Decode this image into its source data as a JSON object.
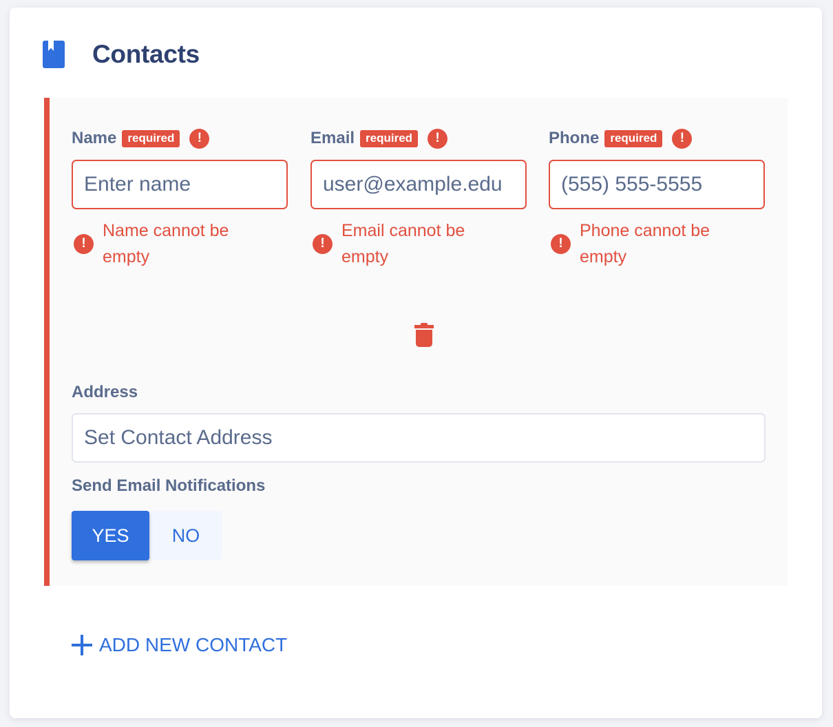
{
  "section": {
    "title": "Contacts",
    "icon": "bookmark-book-icon"
  },
  "contact": {
    "fields": [
      {
        "key": "name",
        "label": "Name",
        "badge": "required",
        "placeholder": "Enter name",
        "value": "",
        "error": "Name cannot be empty"
      },
      {
        "key": "email",
        "label": "Email",
        "badge": "required",
        "placeholder": "user@example.edu",
        "value": "",
        "error": "Email cannot be empty"
      },
      {
        "key": "phone",
        "label": "Phone",
        "badge": "required",
        "placeholder": "(555) 555-5555",
        "value": "",
        "error": "Phone cannot be empty"
      }
    ],
    "delete_icon": "trash-icon",
    "address": {
      "label": "Address",
      "placeholder": "Set Contact Address",
      "value": ""
    },
    "notifications": {
      "label": "Send Email Notifications",
      "options": [
        "YES",
        "NO"
      ],
      "selected": "YES"
    }
  },
  "add_contact_label": "ADD NEW CONTACT",
  "colors": {
    "accent": "#2f6fde",
    "error": "#e2503f",
    "title": "#2e4170",
    "label": "#5a6b8c"
  }
}
